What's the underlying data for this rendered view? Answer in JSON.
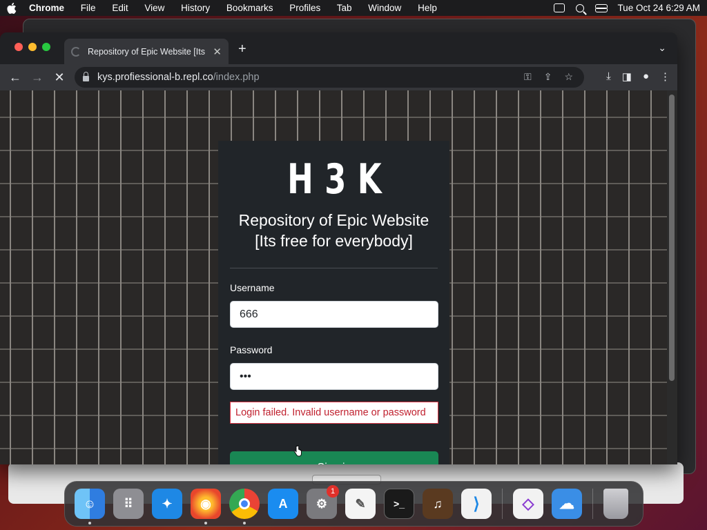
{
  "menubar": {
    "app_name": "Chrome",
    "menus": [
      "File",
      "Edit",
      "View",
      "History",
      "Bookmarks",
      "Profiles",
      "Tab",
      "Window",
      "Help"
    ],
    "datetime": "Tue Oct 24  6:29 AM"
  },
  "browser": {
    "tab_title": "Repository of Epic Website [Its free for everybody]",
    "url_host": "kys.profiessional-b.repl.co",
    "url_path": "/index.php",
    "traffic_lights": [
      "#ff5f57",
      "#febc2e",
      "#28c840"
    ]
  },
  "page": {
    "logo_letters": [
      "H",
      "3",
      "K"
    ],
    "heading_line1": "Repository of Epic Website",
    "heading_line2": "[Its free for everybody]",
    "username_label": "Username",
    "username_value": "666",
    "password_label": "Password",
    "password_value": "•••",
    "error_message": "Login failed. Invalid username or password",
    "signin_label": "Sign in"
  },
  "dock": {
    "apps": [
      {
        "name": "Finder",
        "color": "#2f8cf0",
        "glyph": "☺"
      },
      {
        "name": "Launchpad",
        "color": "#8e8e93",
        "glyph": "⠿"
      },
      {
        "name": "Safari",
        "color": "#1e88e5",
        "glyph": "✦"
      },
      {
        "name": "Firefox",
        "color": "#f26c22",
        "glyph": "◉"
      },
      {
        "name": "Google Chrome",
        "color": "#e8e8e8",
        "glyph": "◎"
      },
      {
        "name": "App Store",
        "color": "#1a8cf0",
        "glyph": "A"
      },
      {
        "name": "System Settings",
        "color": "#7a7a7e",
        "glyph": "⚙"
      },
      {
        "name": "TextEdit",
        "color": "#f4f4f4",
        "glyph": "✎"
      },
      {
        "name": "Terminal",
        "color": "#1a1a1a",
        "glyph": ">_"
      },
      {
        "name": "GarageBand",
        "color": "#5a3a20",
        "glyph": "♫"
      },
      {
        "name": "Visual Studio Code",
        "color": "#f2f2f2",
        "glyph": "⟩"
      },
      {
        "name": "Visual Studio",
        "color": "#f2f2f2",
        "glyph": "◇"
      },
      {
        "name": "Weather",
        "color": "#3a8ee6",
        "glyph": "☁"
      },
      {
        "name": "Trash",
        "color": "#b8b8bc",
        "glyph": "🗑"
      }
    ],
    "settings_badge": "1"
  }
}
